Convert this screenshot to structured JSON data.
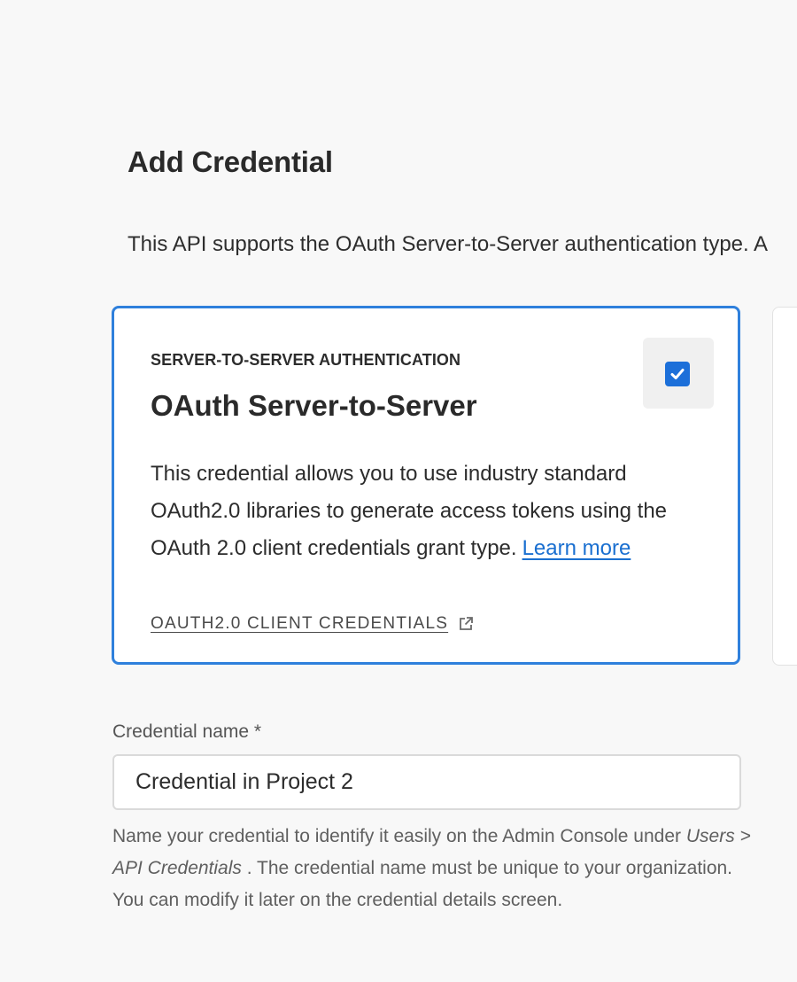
{
  "page": {
    "title": "Add Credential",
    "intro": "This API supports the OAuth Server-to-Server authentication type. A"
  },
  "credential_card": {
    "eyebrow": "SERVER-TO-SERVER AUTHENTICATION",
    "title": "OAuth Server-to-Server",
    "description": "This credential allows you to use industry standard OAuth2.0 libraries to generate access tokens using the OAuth 2.0 client credentials grant type.",
    "learn_more": "Learn more",
    "link_label": "OAUTH2.0 CLIENT CREDENTIALS",
    "link_icon": "external-link-icon",
    "checked": true,
    "checkbox_icon": "checkmark-icon"
  },
  "credential_name": {
    "label": "Credential name *",
    "value": "Credential in Project 2",
    "help_before": "Name your credential to identify it easily on the Admin Console under ",
    "help_path": "Users > API Credentials",
    "help_after": " . The credential name must be unique to your organization. You can modify it later on the credential details screen."
  },
  "colors": {
    "accent": "#2f80dc",
    "checkbox": "#1c6fd9",
    "link": "#1a6fd0",
    "background": "#f8f8f8"
  }
}
